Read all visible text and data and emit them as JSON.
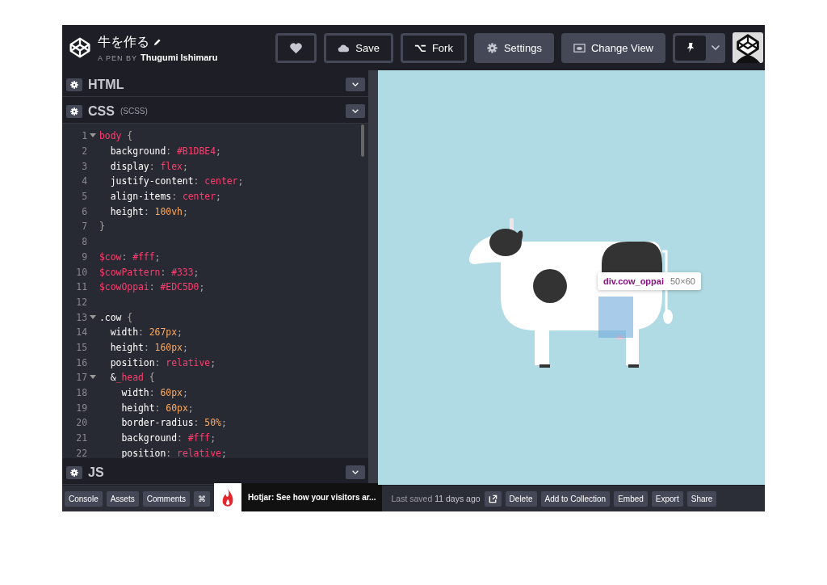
{
  "header": {
    "title": "牛を作る",
    "byline_label": "A PEN BY",
    "author": "Thugumi Ishimaru",
    "buttons": [
      {
        "kind": "outline"
      },
      {
        "kind": "outline",
        "label": "Save"
      },
      {
        "kind": "outline",
        "label": "Fork"
      },
      {
        "kind": "filled",
        "label": "Settings"
      },
      {
        "kind": "filled",
        "label": "Change View"
      }
    ]
  },
  "editors": [
    {
      "title": "HTML"
    },
    {
      "title": "CSS",
      "subtitle": "(SCSS)",
      "code": [
        {
          "n": "1",
          "fold": true,
          "text": "body {"
        },
        {
          "n": "2",
          "text": "  background: #B1DBE4;"
        },
        {
          "n": "3",
          "text": "  display: flex;"
        },
        {
          "n": "4",
          "text": "  justify-content: center;"
        },
        {
          "n": "5",
          "text": "  align-items: center;"
        },
        {
          "n": "6",
          "text": "  height: 100vh;"
        },
        {
          "n": "7",
          "text": "}"
        },
        {
          "n": "8"
        },
        {
          "n": "9",
          "text": "$cow: #fff;"
        },
        {
          "n": "10",
          "text": "$cowPattern: #333;"
        },
        {
          "n": "11",
          "text": "$cowOppai: #EDC5D0;"
        },
        {
          "n": "12"
        },
        {
          "n": "13",
          "fold": true,
          "text": ".cow {"
        },
        {
          "n": "14",
          "text": "  width: 267px;"
        },
        {
          "n": "15",
          "text": "  height: 160px;"
        },
        {
          "n": "16",
          "text": "  position: relative;"
        },
        {
          "n": "17",
          "fold": true,
          "text": "  &_head {"
        },
        {
          "n": "18",
          "text": "    width: 60px;"
        },
        {
          "n": "19",
          "text": "    height: 60px;"
        },
        {
          "n": "20",
          "text": "    border-radius: 50%;"
        },
        {
          "n": "21",
          "text": "    background: #fff;"
        },
        {
          "n": "22",
          "text": "    position: relative;"
        }
      ]
    },
    {
      "title": "JS"
    }
  ],
  "inspector": {
    "selector": "div.cow_oppai",
    "size": "50×60"
  },
  "footer": {
    "left_buttons": [
      "Console",
      "Assets",
      "Comments",
      "⌘"
    ],
    "ad": "Hotjar: See how your visitors ar...",
    "last_saved": "Last saved **11 days ago**",
    "right_buttons": [
      "Delete",
      "Add to Collection",
      "Embed",
      "Export",
      "Share"
    ]
  }
}
